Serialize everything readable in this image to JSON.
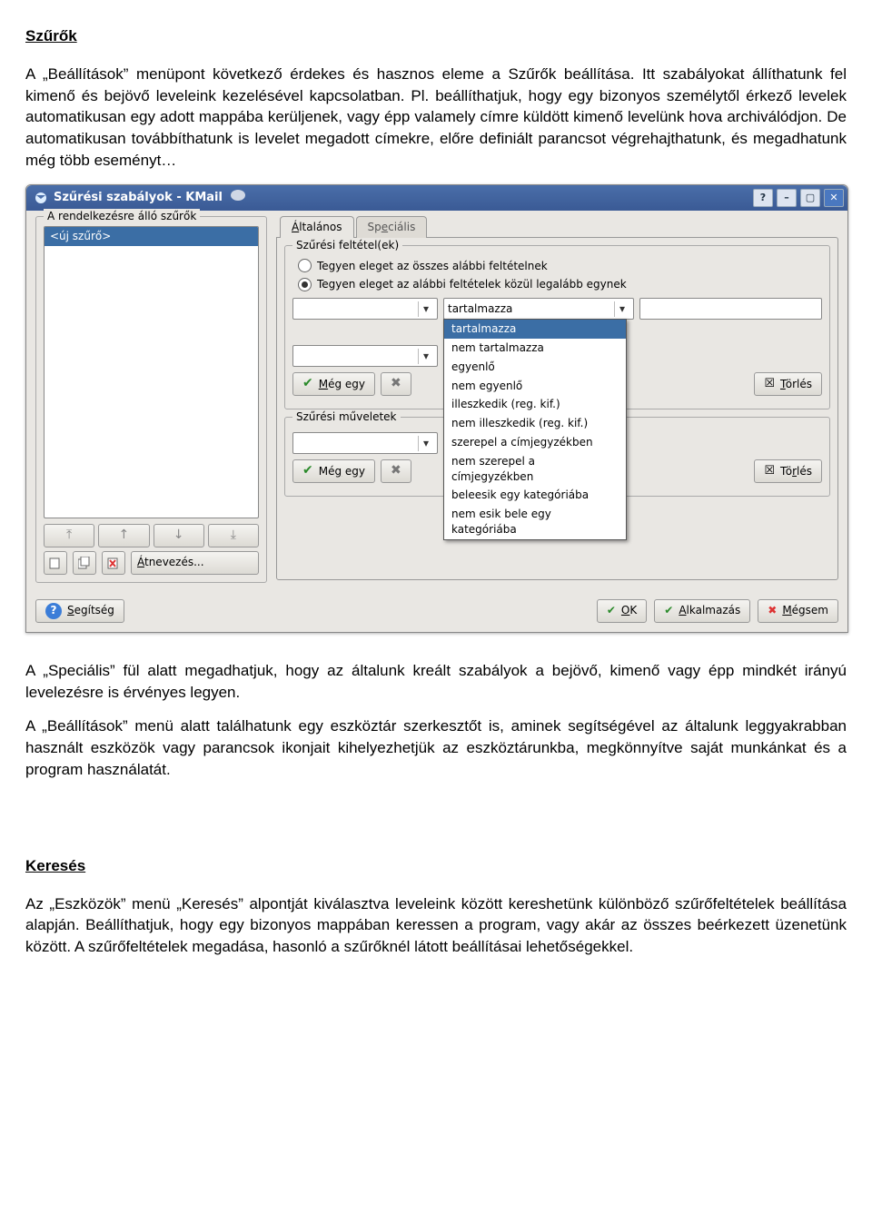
{
  "doc": {
    "heading1": "Szűrők",
    "para1": "A „Beállítások” menüpont következő érdekes és hasznos eleme a Szűrők beállítása. Itt szabályokat állíthatunk fel kimenő és bejövő leveleink kezelésével kapcsolatban. Pl. beállíthatjuk, hogy egy bizonyos személytől érkező levelek automatikusan egy adott mappába kerüljenek, vagy épp valamely címre küldött kimenő levelünk hova archiválódjon. De automatikusan továbbíthatunk is levelet megadott címekre, előre definiált parancsot végrehajthatunk, és megadhatunk még több eseményt…",
    "para2": "A „Speciális” fül alatt megadhatjuk, hogy az általunk kreált szabályok a bejövő, kimenő vagy épp mindkét irányú levelezésre is érvényes legyen.",
    "para3": "A „Beállítások” menü alatt találhatunk egy eszköztár szerkesztőt is, aminek segítségével az általunk leggyakrabban használt eszközök vagy parancsok ikonjait kihelyezhetjük az eszköztárunkba, megkönnyítve saját munkánkat és a program használatát.",
    "heading2": "Keresés",
    "para4": "Az „Eszközök” menü „Keresés” alpontját kiválasztva leveleink között kereshetünk különböző szűrőfeltételek beállítása alapján. Beállíthatjuk, hogy egy  bizonyos mappában keressen a program, vagy akár az összes beérkezett üzenetünk között. A szűrőfeltételek megadása, hasonló a szűrőknél látott beállításai lehetőségekkel."
  },
  "win": {
    "title": "Szűrési szabályok - KMail",
    "left_group": "A rendelkezésre álló szűrők",
    "left_selected": "<új szűrő>",
    "rename": "Átnevezés...",
    "tabs": {
      "general": "Általános",
      "special": "Speciális"
    },
    "cond_group": "Szűrési feltétel(ek)",
    "radio_all": "Tegyen eleget az összes alábbi feltételnek",
    "radio_any": "Tegyen eleget az alábbi feltételek közül legalább egynek",
    "combo_val_selected": "tartalmazza",
    "btn_more": "Még egy",
    "btn_delete": "Törlés",
    "act_group": "Szűrési műveletek",
    "dropdown": [
      "tartalmazza",
      "nem tartalmazza",
      "egyenlő",
      "nem egyenlő",
      "illeszkedik (reg. kif.)",
      "nem illeszkedik (reg. kif.)",
      "szerepel a címjegyzékben",
      "nem szerepel a címjegyzékben",
      "beleesik egy kategóriába",
      "nem esik bele egy kategóriába"
    ],
    "footer": {
      "help": "Segítség",
      "ok": "OK",
      "apply": "Alkalmazás",
      "cancel": "Mégsem"
    }
  }
}
